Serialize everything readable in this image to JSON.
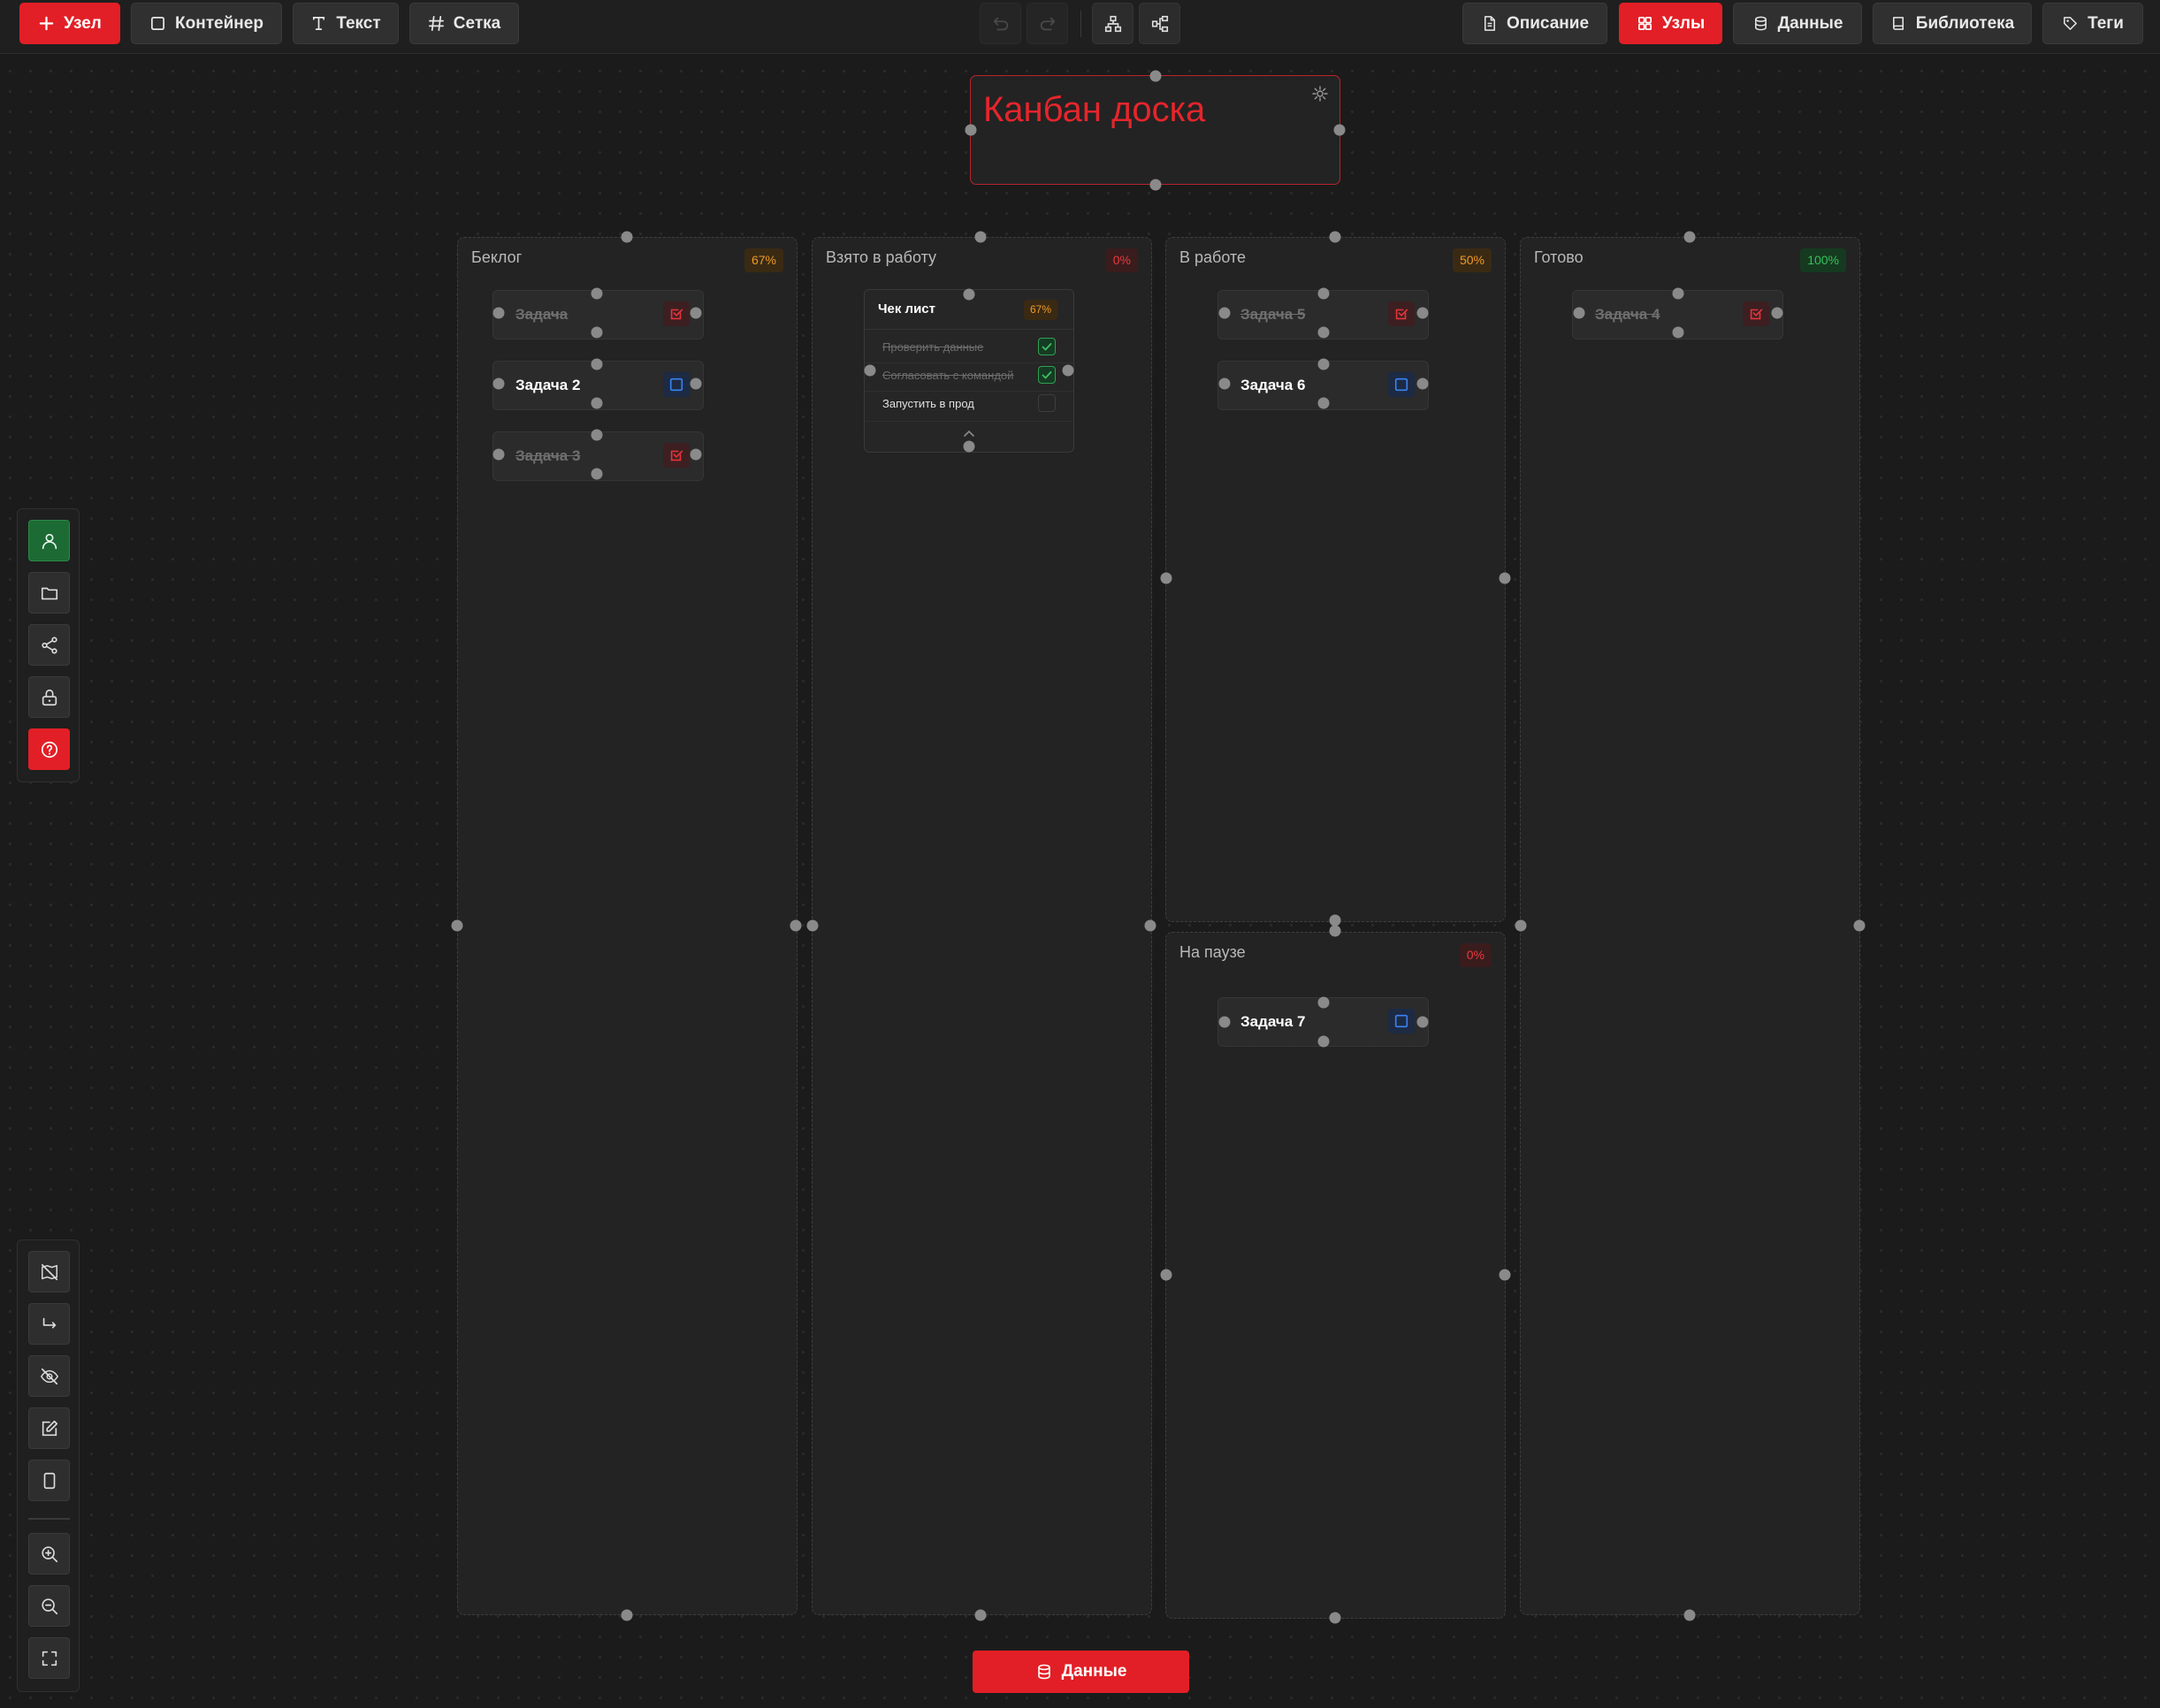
{
  "toolbar": {
    "add_node": "Узел",
    "container": "Контейнер",
    "text": "Текст",
    "grid": "Сетка",
    "description": "Описание",
    "nodes": "Узлы",
    "data": "Данные",
    "library": "Библиотека",
    "tags": "Теги"
  },
  "title_node": {
    "text": "Канбан доска"
  },
  "columns": [
    {
      "title": "Беклог",
      "progress": "67%",
      "tasks": [
        {
          "label": "Задача",
          "done": true
        },
        {
          "label": "Задача 2",
          "done": false
        },
        {
          "label": "Задача 3",
          "done": true
        }
      ]
    },
    {
      "title": "Взято в работу",
      "progress": "0%",
      "checklist": {
        "title": "Чек лист",
        "progress": "67%",
        "items": [
          {
            "label": "Проверить данные",
            "checked": true
          },
          {
            "label": "Согласовать с командой",
            "checked": true
          },
          {
            "label": "Запустить в прод",
            "checked": false
          }
        ]
      }
    },
    {
      "title": "В работе",
      "progress": "50%",
      "tasks": [
        {
          "label": "Задача 5",
          "done": true
        },
        {
          "label": "Задача 6",
          "done": false
        }
      ]
    },
    {
      "title": "На паузе",
      "progress": "0%",
      "tasks": [
        {
          "label": "Задача 7",
          "done": false
        }
      ]
    },
    {
      "title": "Готово",
      "progress": "100%",
      "tasks": [
        {
          "label": "Задача 4",
          "done": true
        }
      ]
    }
  ],
  "bottom": {
    "data_button": "Данные"
  },
  "colors": {
    "accent": "#e21f26",
    "success": "#38c05b",
    "warning": "#ef9a26",
    "info": "#2f6fd6"
  }
}
